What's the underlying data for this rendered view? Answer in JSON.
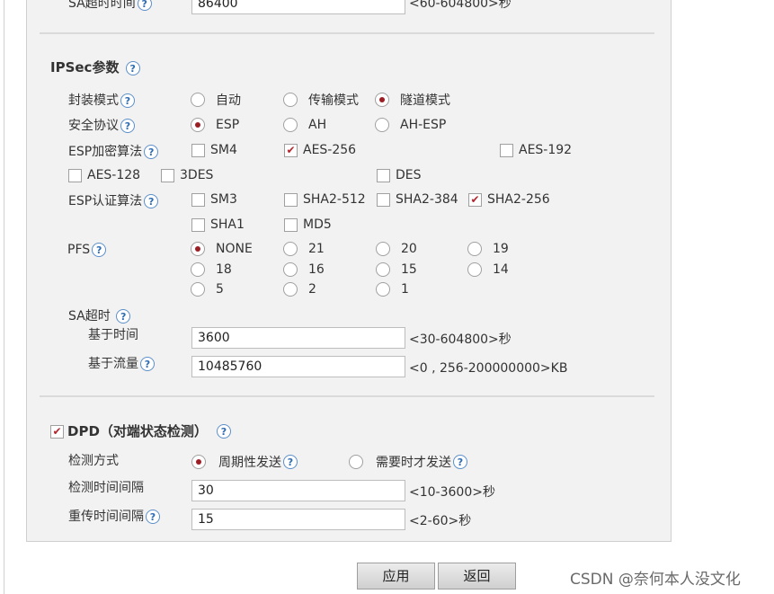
{
  "sa_lifetime_top": {
    "label": "SA超时时间",
    "value": "86400",
    "hint": "<60-604800>秒"
  },
  "ipsec": {
    "title": "IPSec参数",
    "encap": {
      "label": "封装模式",
      "options": [
        "自动",
        "传输模式",
        "隧道模式"
      ],
      "selected": 2
    },
    "protocol": {
      "label": "安全协议",
      "options": [
        "ESP",
        "AH",
        "AH-ESP"
      ],
      "selected": 0
    },
    "esp_enc": {
      "label": "ESP加密算法",
      "options": [
        {
          "label": "SM4",
          "checked": false
        },
        {
          "label": "AES-256",
          "checked": true
        },
        {
          "label": "AES-192",
          "checked": false
        },
        {
          "label": "AES-128",
          "checked": false
        },
        {
          "label": "3DES",
          "checked": false
        },
        {
          "label": "DES",
          "checked": false
        }
      ]
    },
    "esp_auth": {
      "label": "ESP认证算法",
      "options": [
        {
          "label": "SM3",
          "checked": false
        },
        {
          "label": "SHA2-512",
          "checked": false
        },
        {
          "label": "SHA2-384",
          "checked": false
        },
        {
          "label": "SHA2-256",
          "checked": true
        },
        {
          "label": "SHA1",
          "checked": false
        },
        {
          "label": "MD5",
          "checked": false
        }
      ]
    },
    "pfs": {
      "label": "PFS",
      "options": [
        "NONE",
        "21",
        "20",
        "19",
        "18",
        "16",
        "15",
        "14",
        "5",
        "2",
        "1"
      ],
      "selected": 0
    },
    "sa_timeout": {
      "label": "SA超时",
      "time": {
        "label": "基于时间",
        "value": "3600",
        "hint": "<30-604800>秒"
      },
      "traffic": {
        "label": "基于流量",
        "value": "10485760",
        "hint": "<0 , 256-200000000>KB"
      }
    }
  },
  "dpd": {
    "title": "DPD（对端状态检测）",
    "enabled": true,
    "mode": {
      "label": "检测方式",
      "options": [
        "周期性发送",
        "需要时才发送"
      ],
      "selected": 0
    },
    "interval": {
      "label": "检测时间间隔",
      "value": "30",
      "hint": "<10-3600>秒"
    },
    "retrans": {
      "label": "重传时间间隔",
      "value": "15",
      "hint": "<2-60>秒"
    }
  },
  "buttons": {
    "apply": "应用",
    "back": "返回"
  },
  "help_glyph": "?",
  "watermark": "CSDN @奈何本人没文化",
  "colors": {
    "accent": "#9c1e25",
    "help": "#2f6db3",
    "panel": "#f2f2f2"
  }
}
